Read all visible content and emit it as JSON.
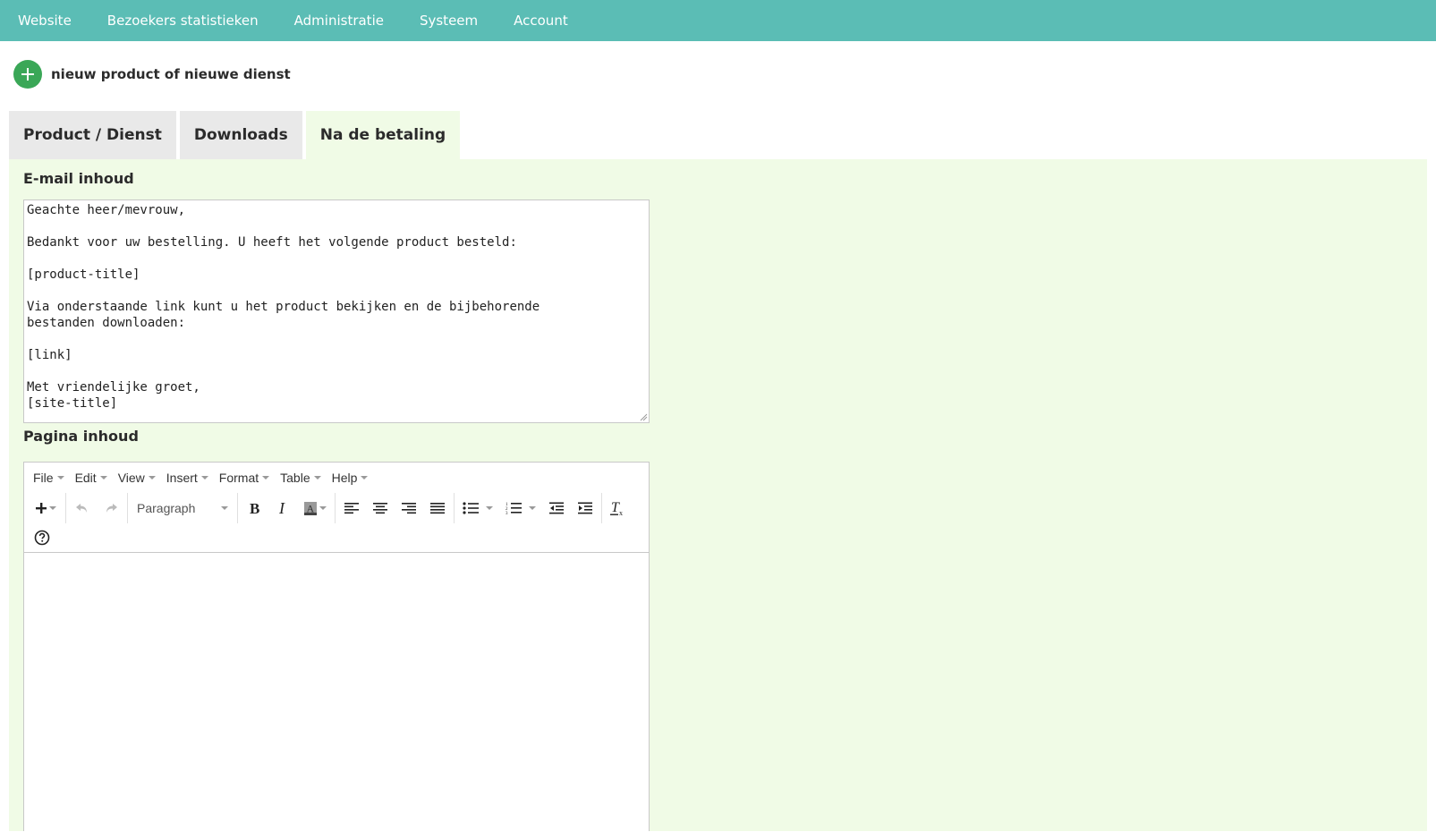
{
  "nav": {
    "items": [
      "Website",
      "Bezoekers statistieken",
      "Administratie",
      "Systeem",
      "Account"
    ]
  },
  "header": {
    "title": "nieuw product of nieuwe dienst"
  },
  "tabs": [
    {
      "label": "Product / Dienst",
      "active": false
    },
    {
      "label": "Downloads",
      "active": false
    },
    {
      "label": "Na de betaling",
      "active": true
    }
  ],
  "email": {
    "label": "E-mail inhoud",
    "content": "Geachte heer/mevrouw,\n\nBedankt voor uw bestelling. U heeft het volgende product besteld:\n\n[product-title]\n\nVia onderstaande link kunt u het product bekijken en de bijbehorende\nbestanden downloaden:\n\n[link]\n\nMet vriendelijke groet,\n[site-title]"
  },
  "page": {
    "label": "Pagina inhoud",
    "menus": [
      "File",
      "Edit",
      "View",
      "Insert",
      "Format",
      "Table",
      "Help"
    ],
    "block_format": "Paragraph",
    "content": ""
  },
  "colors": {
    "nav_bg": "#5bbdb5",
    "panel_bg": "#f0fbe6",
    "tab_bg": "#e9e9e9",
    "add_button": "#3aa757"
  },
  "icons": {
    "add": "plus-circle-icon",
    "toolbar": [
      "insert-icon",
      "undo-icon",
      "redo-icon",
      "bold-icon",
      "italic-icon",
      "text-color-icon",
      "align-left-icon",
      "align-center-icon",
      "align-right-icon",
      "align-justify-icon",
      "bullet-list-icon",
      "numbered-list-icon",
      "outdent-icon",
      "indent-icon",
      "clear-formatting-icon",
      "help-icon"
    ]
  }
}
